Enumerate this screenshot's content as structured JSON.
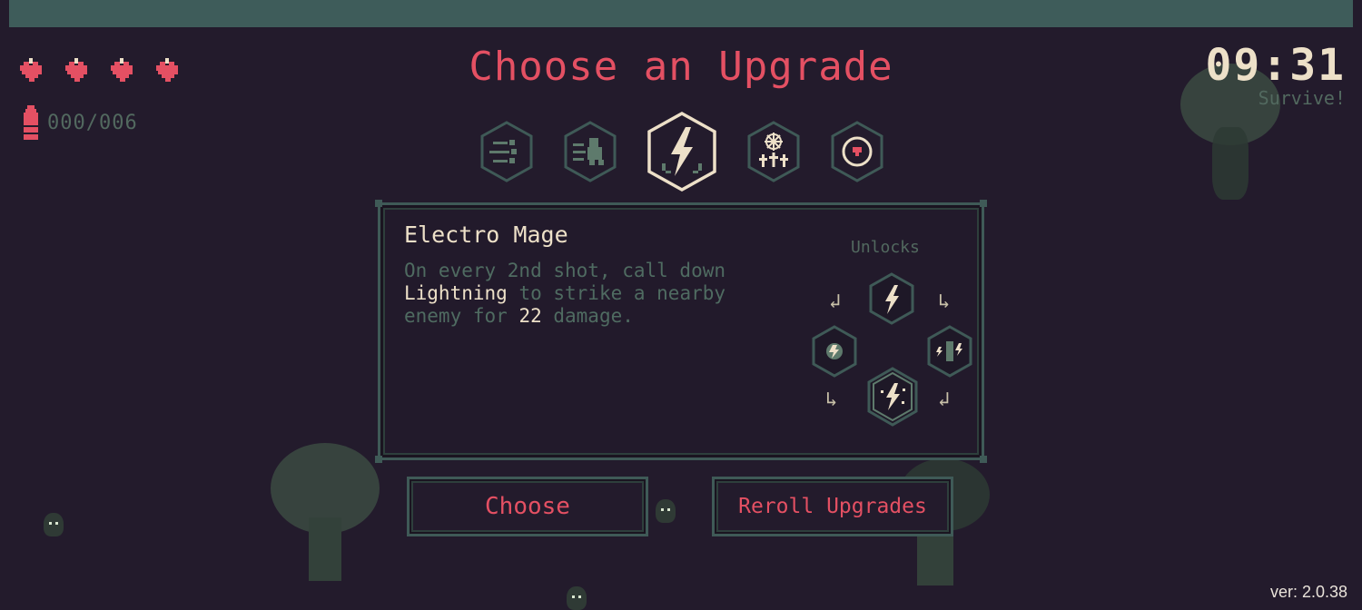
{
  "hud": {
    "hearts": 4,
    "ammo": "000/006",
    "timer": "09:31",
    "status": "Survive!"
  },
  "title": "Choose an Upgrade",
  "tabs": [
    {
      "icon": "projectile-split-icon",
      "selected": false
    },
    {
      "icon": "speed-runner-icon",
      "selected": false
    },
    {
      "icon": "lightning-bolt-icon",
      "selected": true
    },
    {
      "icon": "holy-tree-icon",
      "selected": false
    },
    {
      "icon": "shield-orb-icon",
      "selected": false
    }
  ],
  "upgrade": {
    "name": "Electro Mage",
    "desc_1": "On every 2nd shot, call down",
    "desc_hl_1": "Lightning",
    "desc_2": " to strike a nearby",
    "desc_3": "enemy for ",
    "desc_hl_2": "22",
    "desc_4": " damage.",
    "unlocks_label": "Unlocks"
  },
  "buttons": {
    "choose": "Choose",
    "reroll": "Reroll Upgrades"
  },
  "version": "ver: 2.0.38",
  "colors": {
    "accent": "#e45063",
    "frame": "#3f5a57",
    "muted_text": "#4f6b61",
    "bright_text": "#ede0c8",
    "background": "#231b2c"
  }
}
